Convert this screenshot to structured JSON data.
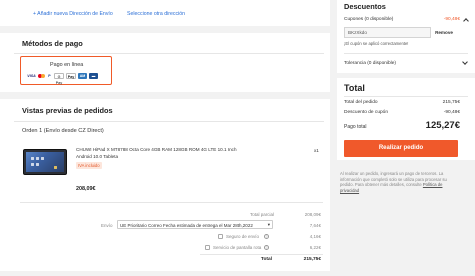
{
  "address": {
    "add_link": "+ Añadir nueva Dirección de Envío",
    "select_link": "Seleccione otra dirección"
  },
  "payment": {
    "title": "Métodos de pago",
    "option_label": "Pago en línea",
    "logos": [
      "VISA",
      "MC",
      "PP",
      "GPay",
      "APay",
      "AMEX",
      "CARD"
    ]
  },
  "previews": {
    "title": "Vistas previas de pedidos",
    "order_title": "Orden 1 (Envío desde CZ Direct)",
    "product": {
      "name_line1": "CHUWI HiPad X MT8788 Octa Core 4GB RAM 128GB ROM 4G LTE 10.1 Inch",
      "name_line2": "Android 10.0 Tableta",
      "tag": "IVA incluido",
      "qty": "x1",
      "price": "208,09€"
    },
    "summary": {
      "subtotal_label": "Total parcial",
      "subtotal_value": "208,09€",
      "shipping_label": "Envío",
      "shipping_option": "UE Prioritario Correo Fecha estimada de entrega el Mar 28th,2022",
      "shipping_value": "7,64€",
      "insurance_label": "Seguro de envío",
      "insurance_value": "4,16€",
      "screen_label": "Servicio de pantalla rota",
      "screen_value": "6,22€",
      "total_label": "Total",
      "total_value": "215,75€"
    }
  },
  "sidebar": {
    "discounts_title": "Descuentos",
    "coupons_label": "Cupones (0 disponible)",
    "coupons_value": "-90,48€",
    "coupon_code": "BKzXkdo",
    "apply_label": "Remove",
    "coupon_success": "¡El cupón se aplicó correctamente!",
    "tolerance_label": "Tolerancia (0 disponible)",
    "total_title": "Total",
    "order_total_label": "Total del pedido",
    "order_total_value": "215,75€",
    "coupon_discount_label": "Descuento de cupón",
    "coupon_discount_value": "-90,48€",
    "pay_total_label": "Pago total",
    "pay_total_value": "125,27€",
    "place_order_button": "Realizar pedido",
    "notice_text": "Al realizar un pedido, ingresará un pago de terceros. La información que completó solo se utiliza para procesar su pedido. Para obtener más detalles, consulte",
    "notice_link": "Política de privacidad",
    "accent_color": "#f0592b"
  }
}
